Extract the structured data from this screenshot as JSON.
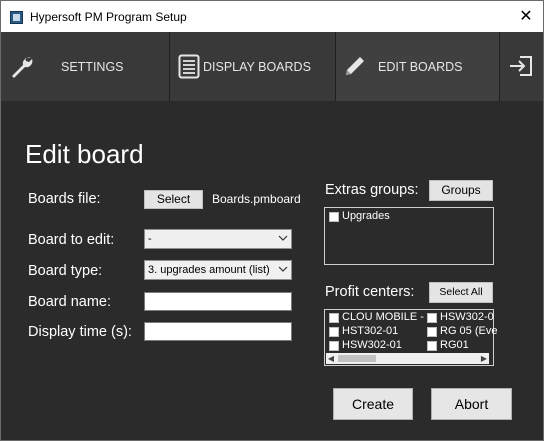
{
  "window": {
    "title": "Hypersoft PM Program Setup",
    "close_glyph": "✕"
  },
  "nav": {
    "tabs": [
      {
        "label": "SETTINGS",
        "icon": "wrench-icon"
      },
      {
        "label": "DISPLAY BOARDS",
        "icon": "list-document-icon"
      },
      {
        "label": "EDIT BOARDS",
        "icon": "pencil-icon",
        "active": true
      }
    ],
    "exit_icon": "exit-icon"
  },
  "form": {
    "heading": "Edit board",
    "boards_file_label": "Boards file:",
    "select_button": "Select",
    "boards_file_value": "Boards.pmboard",
    "board_to_edit_label": "Board to edit:",
    "board_to_edit_value": "-",
    "board_type_label": "Board type:",
    "board_type_value": "3. upgrades amount (list)",
    "board_name_label": "Board name:",
    "board_name_value": "",
    "display_time_label": "Display time (s):",
    "display_time_value": ""
  },
  "extras": {
    "label": "Extras groups:",
    "button": "Groups",
    "items": [
      {
        "label": "Upgrades",
        "checked": false
      }
    ]
  },
  "profit_centers": {
    "label": "Profit centers:",
    "button": "Select All",
    "items": [
      {
        "label": "CLOU MOBILE -",
        "checked": false
      },
      {
        "label": "HST302-01",
        "checked": false
      },
      {
        "label": "HSW302-01",
        "checked": false
      },
      {
        "label": "HSW302-0",
        "checked": false
      },
      {
        "label": "RG 05 (Eve",
        "checked": false
      },
      {
        "label": "RG01",
        "checked": false
      }
    ]
  },
  "actions": {
    "create": "Create",
    "abort": "Abort"
  },
  "colors": {
    "accent": "#3fa5b0",
    "background": "#2b2b2b",
    "nav": "#393939"
  }
}
